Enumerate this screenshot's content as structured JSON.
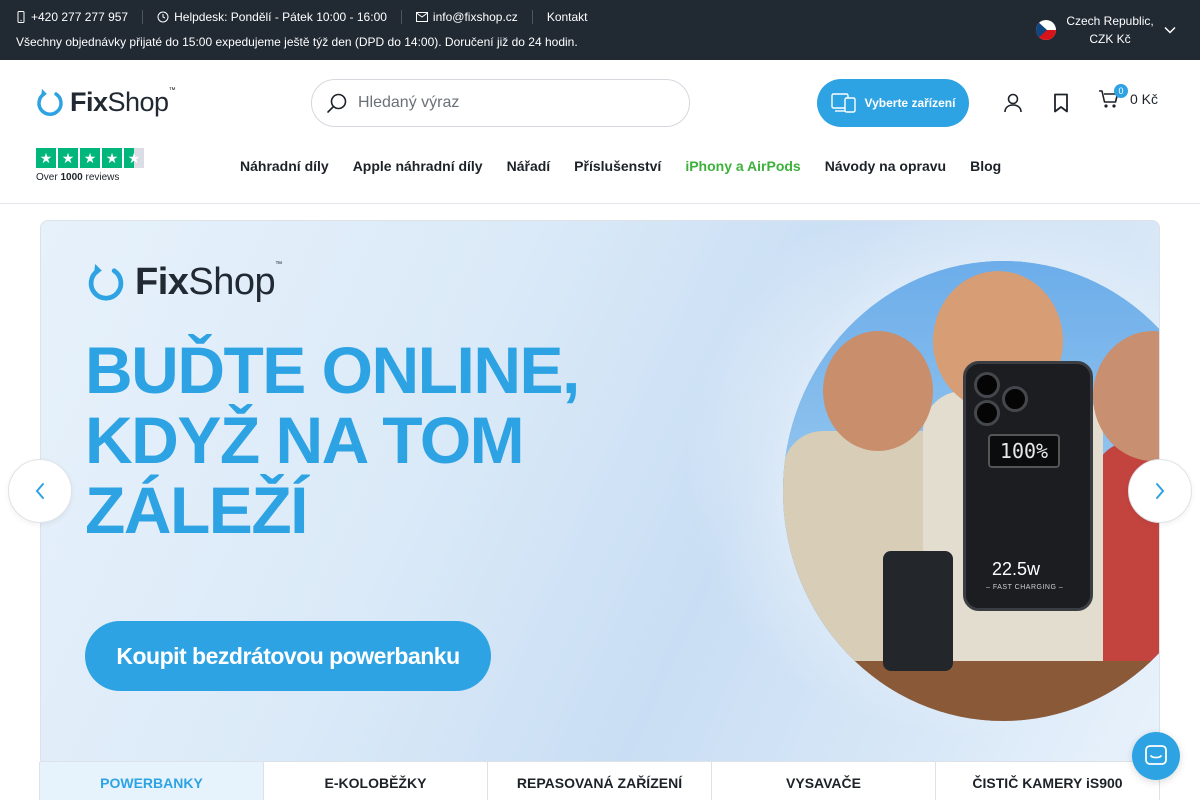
{
  "topbar": {
    "phone": "+420 277 277 957",
    "helpdesk": "Helpdesk: Pondělí - Pátek 10:00 - 16:00",
    "email": "info@fixshop.cz",
    "contact": "Kontakt",
    "shipping_note": "Všechny objednávky přijaté do 15:00 expedujeme ještě týž den (DPD do 14:00). Doručení již do 24 hodin.",
    "region_line1": "Czech Republic,",
    "region_line2": "CZK Kč"
  },
  "header": {
    "logo_bold": "Fix",
    "logo_light": "Shop",
    "logo_tm": "™",
    "search_placeholder": "Hledaný výraz",
    "device_button": "Vyberte zařízení",
    "cart_count": "0",
    "cart_total": "0 Kč",
    "reviews_prefix": "Over",
    "reviews_count": "1000",
    "reviews_suffix": "reviews"
  },
  "nav": {
    "items": [
      {
        "label": "Náhradní díly"
      },
      {
        "label": "Apple náhradní díly"
      },
      {
        "label": "Nářadí"
      },
      {
        "label": "Příslušenství"
      },
      {
        "label": "iPhony a AirPods"
      },
      {
        "label": "Návody na opravu"
      },
      {
        "label": "Blog"
      }
    ]
  },
  "banner": {
    "headline_line1": "BUĎTE ONLINE,",
    "headline_line2": "KDYŽ NA TOM",
    "headline_line3": "ZÁLEŽÍ",
    "cta": "Koupit bezdrátovou powerbanku",
    "powerbank_percent": "100%",
    "powerbank_watt": "22.5w",
    "powerbank_fast": "– FAST CHARGING –"
  },
  "tabs": [
    {
      "label": "POWERBANKY"
    },
    {
      "label": "E-KOLOBĚŽKY"
    },
    {
      "label": "REPASOVANÁ ZAŘÍZENÍ"
    },
    {
      "label": "VYSAVAČE"
    },
    {
      "label": "ČISTIČ KAMERY iS900"
    }
  ],
  "colors": {
    "accent": "#2ea3e3",
    "topbar_bg": "#212933",
    "highlight_nav": "#3db13c",
    "trustpilot": "#00b67a"
  }
}
